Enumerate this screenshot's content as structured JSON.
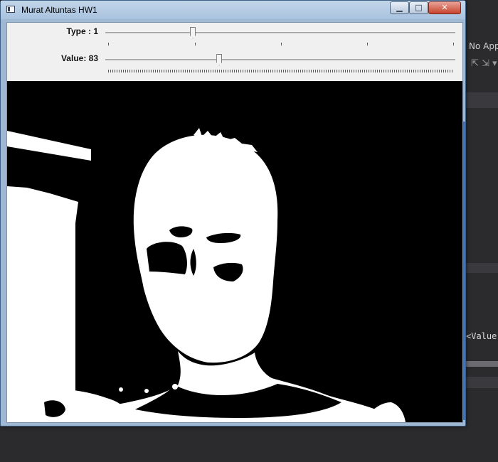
{
  "window": {
    "title": "Murat Altuntas HW1",
    "controls": {
      "minimize": "▁",
      "maximize": "□",
      "close": "✕"
    }
  },
  "trackbars": [
    {
      "label": "Type : 1",
      "value": 1,
      "min": 0,
      "max": 4
    },
    {
      "label": "Value: 83",
      "value": 83,
      "min": 0,
      "max": 255
    }
  ],
  "image": {
    "description_free": true
  },
  "background": {
    "ide_text_top": "No App",
    "ide_code": "<Value"
  },
  "colors": {
    "window_frame": "#9fb8d4",
    "title_gradient_top": "#c3d6ea",
    "client_bg": "#f0f0f0",
    "image_bg": "#000000"
  }
}
